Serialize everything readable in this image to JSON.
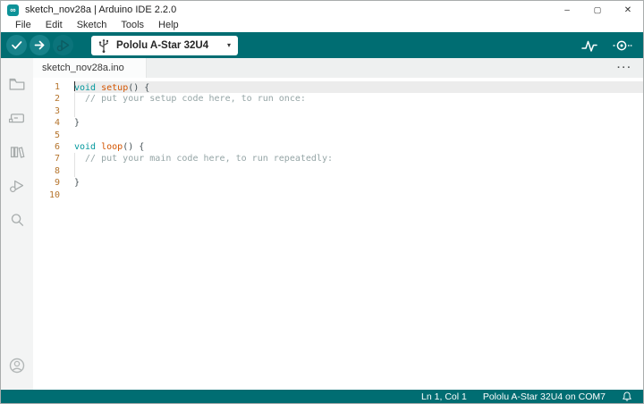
{
  "window": {
    "icon": "arduino-logo-icon",
    "logo_glyph": "∞",
    "title": "sketch_nov28a | Arduino IDE 2.2.0",
    "controls": {
      "minimize": "–",
      "maximize": "▢",
      "close": "✕"
    }
  },
  "menu": {
    "items": [
      "File",
      "Edit",
      "Sketch",
      "Tools",
      "Help"
    ]
  },
  "toolbar": {
    "icons": {
      "verify": "check-icon",
      "upload": "right-arrow-icon",
      "debug": "debug-icon",
      "serial_plotter": "waveform-icon",
      "serial_monitor": "magnifier-icon"
    },
    "board_selector": {
      "value": "Pololu A-Star 32U4",
      "icon": "usb-icon",
      "caret": "▾"
    }
  },
  "tabs": {
    "items": [
      {
        "label": "sketch_nov28a.ino",
        "active": true
      }
    ],
    "overflow_glyph": "···"
  },
  "sidebar": {
    "items": [
      "sketchbook-folder",
      "boards-manager",
      "library-manager",
      "debugger",
      "search"
    ],
    "account": "account"
  },
  "editor": {
    "lines": [
      {
        "n": 1,
        "active": true,
        "caret": true,
        "tokens": [
          [
            "kw",
            "void"
          ],
          [
            "pl",
            " "
          ],
          [
            "fn",
            "setup"
          ],
          [
            "pl",
            "() {"
          ]
        ]
      },
      {
        "n": 2,
        "tokens": [
          [
            "cm",
            "  // put your setup code here, to run once:"
          ]
        ],
        "guide": true
      },
      {
        "n": 3,
        "tokens": [],
        "guide": true
      },
      {
        "n": 4,
        "tokens": [
          [
            "pl",
            "}"
          ]
        ]
      },
      {
        "n": 5,
        "tokens": []
      },
      {
        "n": 6,
        "tokens": [
          [
            "kw",
            "void"
          ],
          [
            "pl",
            " "
          ],
          [
            "fn",
            "loop"
          ],
          [
            "pl",
            "() {"
          ]
        ]
      },
      {
        "n": 7,
        "tokens": [
          [
            "cm",
            "  // put your main code here, to run repeatedly:"
          ]
        ],
        "guide": true
      },
      {
        "n": 8,
        "tokens": [],
        "guide": true
      },
      {
        "n": 9,
        "tokens": [
          [
            "pl",
            "}"
          ]
        ]
      },
      {
        "n": 10,
        "tokens": []
      }
    ]
  },
  "statusbar": {
    "cursor_position": "Ln 1, Col 1",
    "connection": "Pololu A-Star 32U4 on COM7",
    "notification_icon": "bell-icon"
  },
  "colors": {
    "teal": "#006d72",
    "button_teal": "#17828a",
    "keyword": "#00979c",
    "function": "#d35400",
    "comment": "#95a5a6",
    "line_number": "#b5742c",
    "active_line": "#ececec"
  }
}
